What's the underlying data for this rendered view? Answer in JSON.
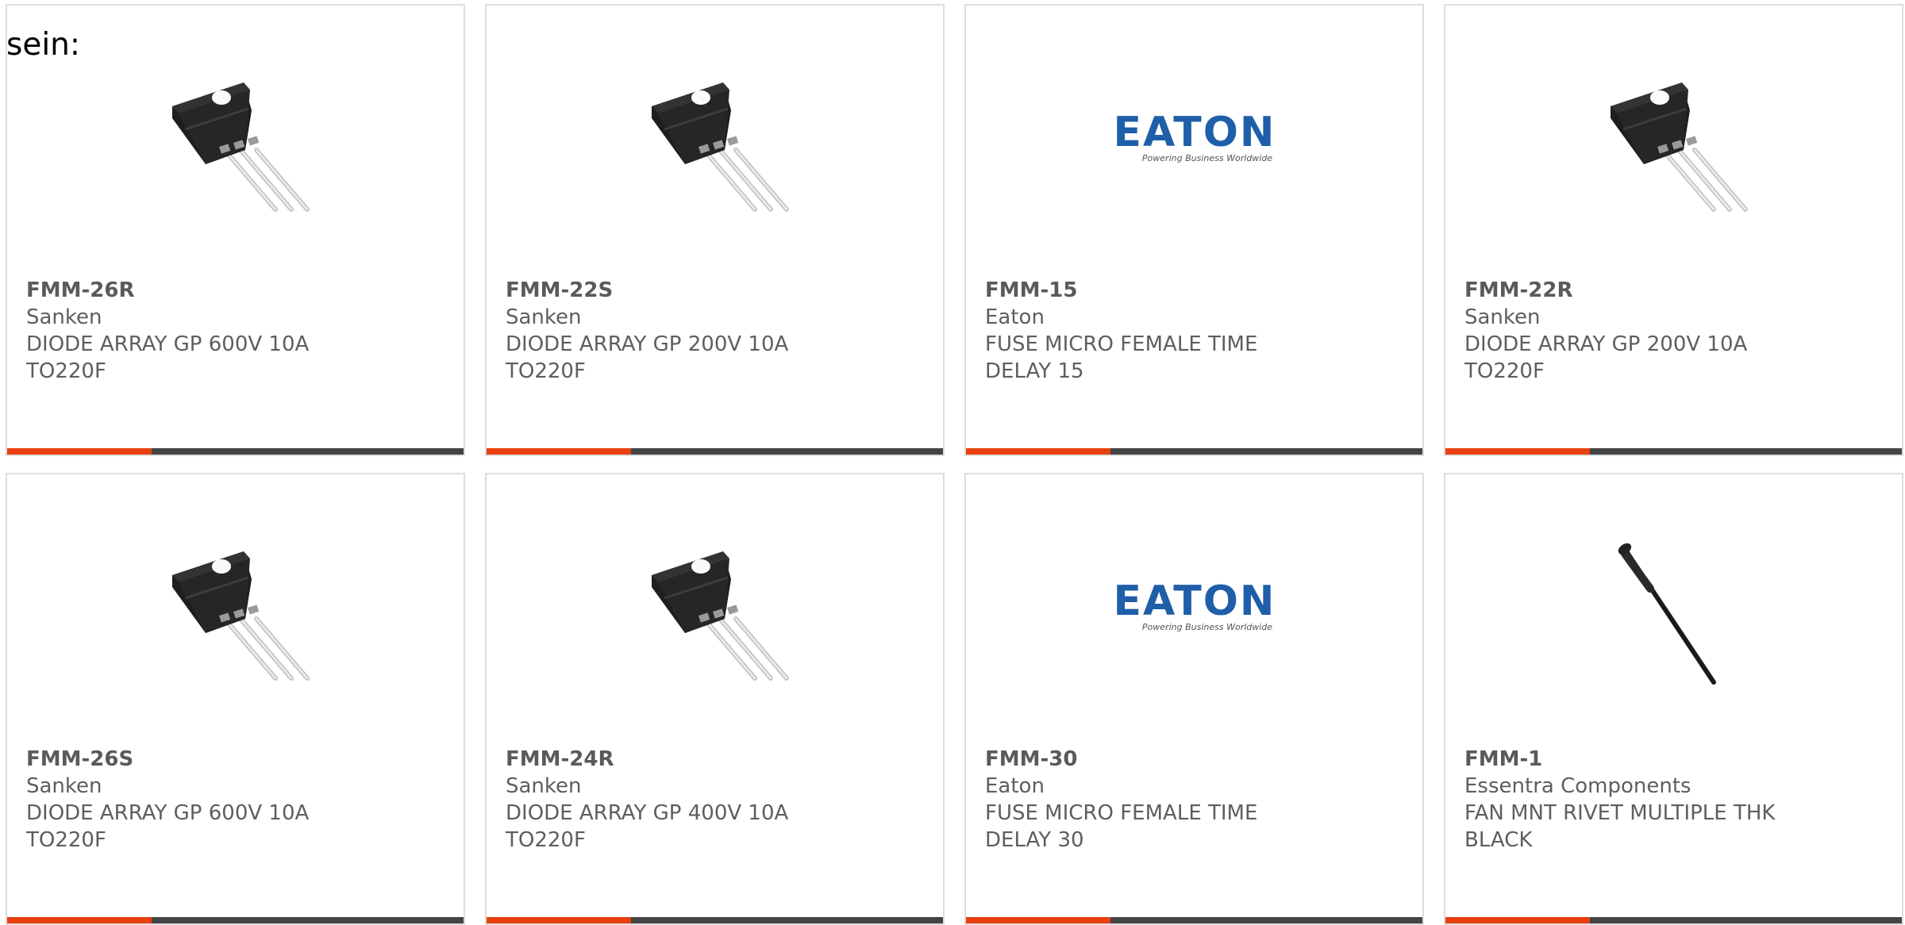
{
  "intro_text": "sein:",
  "colors": {
    "accent": "#e8400f",
    "bar": "#444444",
    "border": "#dddddd",
    "text": "#5e5e5e"
  },
  "products": [
    {
      "part": "FMM-26R",
      "manufacturer": "Sanken",
      "description": "DIODE ARRAY GP 600V 10A TO220F",
      "image": "to220f-transistor"
    },
    {
      "part": "FMM-22S",
      "manufacturer": "Sanken",
      "description": "DIODE ARRAY GP 200V 10A TO220F",
      "image": "to220f-transistor"
    },
    {
      "part": "FMM-15",
      "manufacturer": "Eaton",
      "description": "FUSE MICRO FEMALE TIME DELAY 15",
      "image": "eaton-logo",
      "logo_text": "EATON",
      "logo_tagline": "Powering Business Worldwide"
    },
    {
      "part": "FMM-22R",
      "manufacturer": "Sanken",
      "description": "DIODE ARRAY GP 200V 10A TO220F",
      "image": "to220f-transistor"
    },
    {
      "part": "FMM-26S",
      "manufacturer": "Sanken",
      "description": "DIODE ARRAY GP 600V 10A TO220F",
      "image": "to220f-transistor"
    },
    {
      "part": "FMM-24R",
      "manufacturer": "Sanken",
      "description": "DIODE ARRAY GP 400V 10A TO220F",
      "image": "to220f-transistor"
    },
    {
      "part": "FMM-30",
      "manufacturer": "Eaton",
      "description": "FUSE MICRO FEMALE TIME DELAY 30",
      "image": "eaton-logo",
      "logo_text": "EATON",
      "logo_tagline": "Powering Business Worldwide"
    },
    {
      "part": "FMM-1",
      "manufacturer": "Essentra Components",
      "description": "FAN MNT RIVET MULTIPLE THK BLACK",
      "image": "fan-rivet"
    }
  ]
}
